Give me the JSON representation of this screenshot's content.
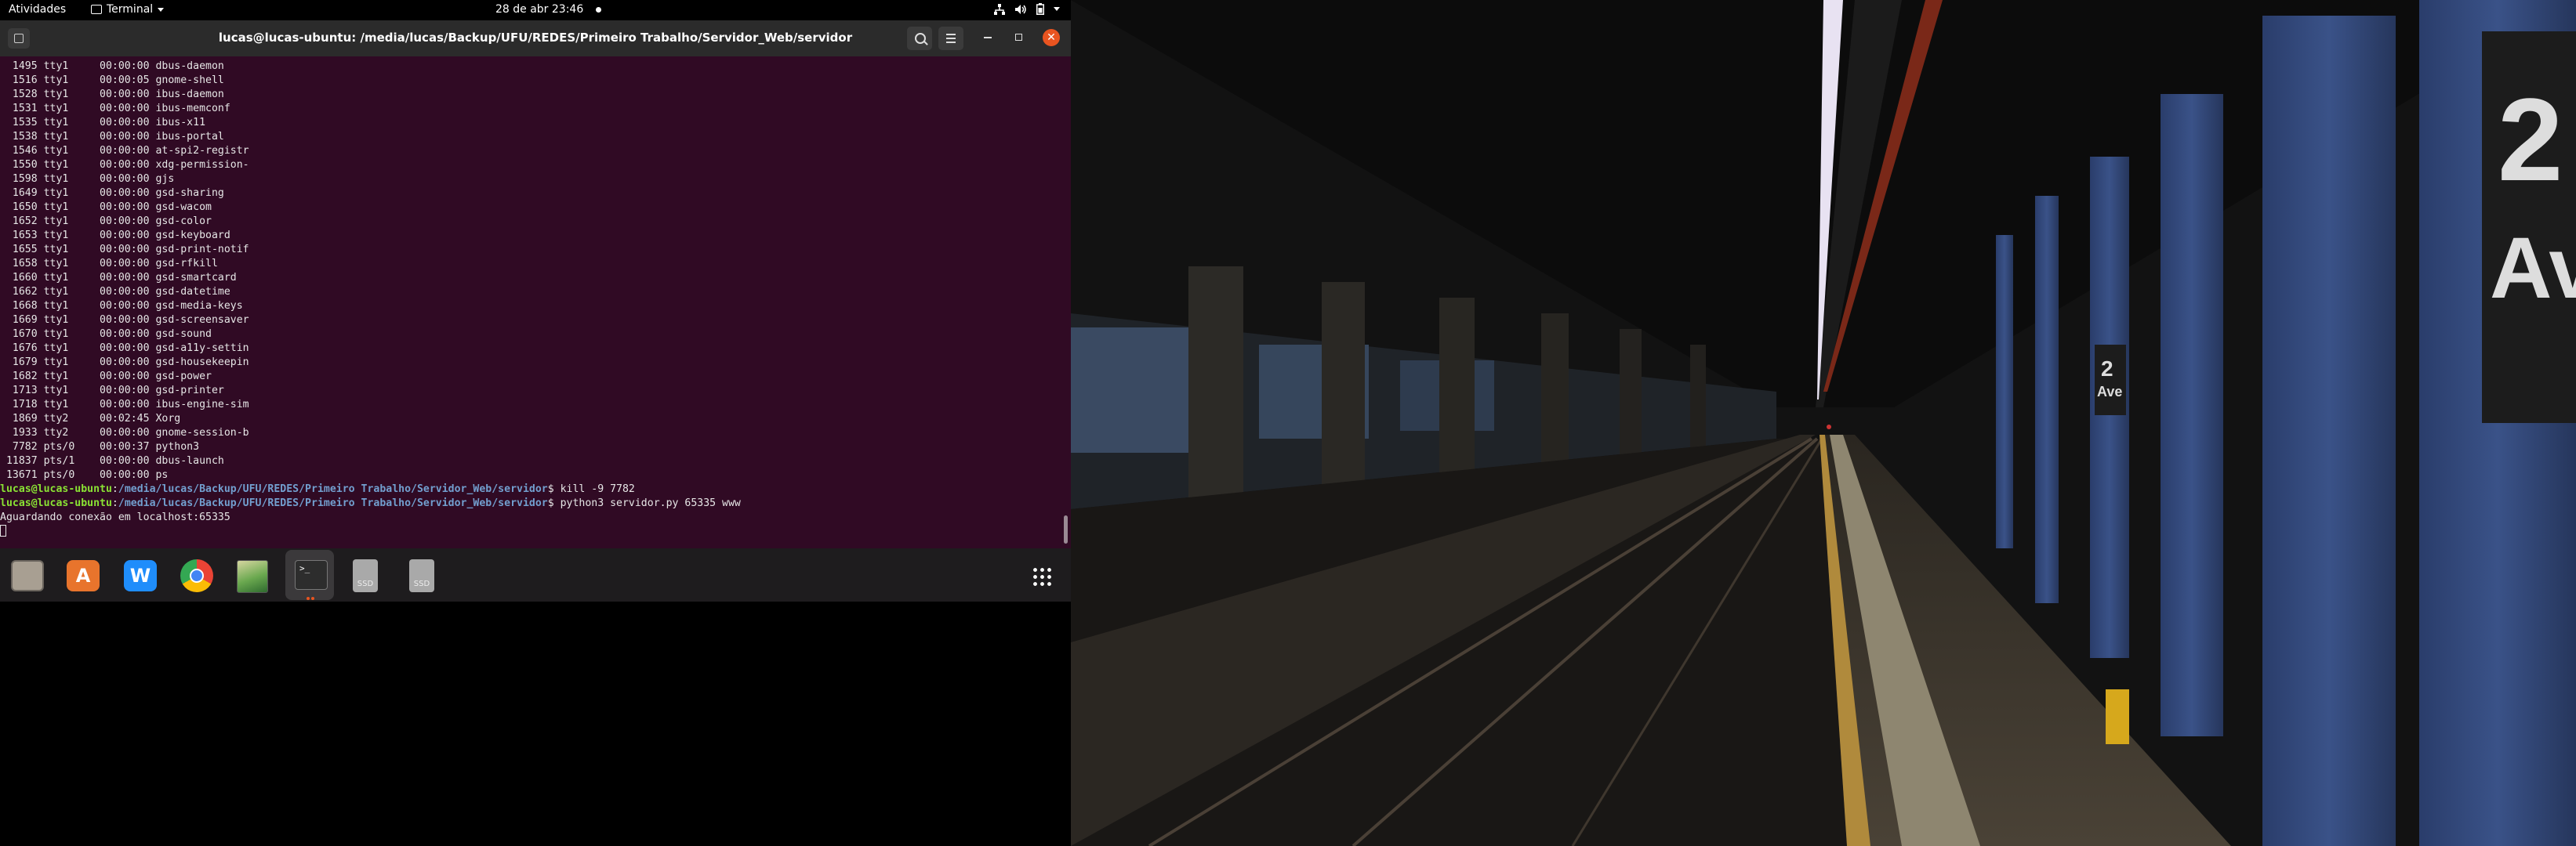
{
  "top_bar": {
    "activities": "Atividades",
    "app_menu": "Terminal",
    "clock": "28 de abr  23:46"
  },
  "window": {
    "title": "lucas@lucas-ubuntu: /media/lucas/Backup/UFU/REDES/Primeiro Trabalho/Servidor_Web/servidor"
  },
  "terminal": {
    "processes": [
      "  1495 tty1     00:00:00 dbus-daemon",
      "  1516 tty1     00:00:05 gnome-shell",
      "  1528 tty1     00:00:00 ibus-daemon",
      "  1531 tty1     00:00:00 ibus-memconf",
      "  1535 tty1     00:00:00 ibus-x11",
      "  1538 tty1     00:00:00 ibus-portal",
      "  1546 tty1     00:00:00 at-spi2-registr",
      "  1550 tty1     00:00:00 xdg-permission-",
      "  1598 tty1     00:00:00 gjs",
      "  1649 tty1     00:00:00 gsd-sharing",
      "  1650 tty1     00:00:00 gsd-wacom",
      "  1652 tty1     00:00:00 gsd-color",
      "  1653 tty1     00:00:00 gsd-keyboard",
      "  1655 tty1     00:00:00 gsd-print-notif",
      "  1658 tty1     00:00:00 gsd-rfkill",
      "  1660 tty1     00:00:00 gsd-smartcard",
      "  1662 tty1     00:00:00 gsd-datetime",
      "  1668 tty1     00:00:00 gsd-media-keys",
      "  1669 tty1     00:00:00 gsd-screensaver",
      "  1670 tty1     00:00:00 gsd-sound",
      "  1676 tty1     00:00:00 gsd-a11y-settin",
      "  1679 tty1     00:00:00 gsd-housekeepin",
      "  1682 tty1     00:00:00 gsd-power",
      "  1713 tty1     00:00:00 gsd-printer",
      "  1718 tty1     00:00:00 ibus-engine-sim",
      "  1869 tty2     00:02:45 Xorg",
      "  1933 tty2     00:00:00 gnome-session-b",
      "  7782 pts/0    00:00:37 python3",
      " 11837 pts/1    00:00:00 dbus-launch",
      " 13671 pts/0    00:00:00 ps"
    ],
    "prompt_user": "lucas@lucas-ubuntu",
    "prompt_sep": ":",
    "prompt_path": "/media/lucas/Backup/UFU/REDES/Primeiro Trabalho/Servidor_Web/servidor",
    "prompt_symbol": "$ ",
    "commands": [
      "kill -9 7782",
      "python3 servidor.py 65335 www"
    ],
    "output": "Aguardando conexão em localhost:65335"
  },
  "dock": {
    "items": [
      {
        "icon": "files-icon"
      },
      {
        "icon": "software-store-icon"
      },
      {
        "icon": "wps-office-icon"
      },
      {
        "icon": "chrome-icon"
      },
      {
        "icon": "image-viewer-icon"
      },
      {
        "icon": "terminal-icon",
        "label": ">_"
      },
      {
        "icon": "drive-icon",
        "label": "SSD"
      },
      {
        "icon": "drive-icon",
        "label": "SSD"
      },
      {
        "icon": "app-grid-icon"
      }
    ]
  },
  "wallpaper": {
    "sign_number": "2",
    "sign_text": "Ave",
    "small_sign_number": "2",
    "small_sign_text": "Ave"
  }
}
